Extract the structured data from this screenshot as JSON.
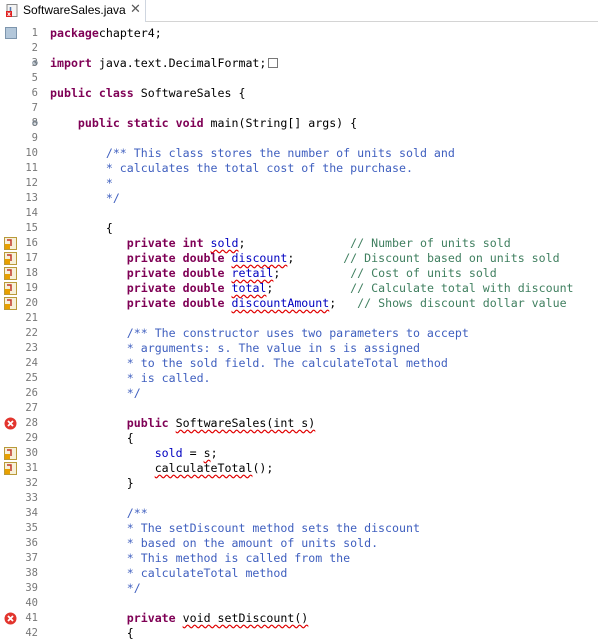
{
  "tab": {
    "title": "SoftwareSales.java",
    "close": "✕"
  },
  "colors": {
    "keyword": "#7f0055",
    "comment": "#3f7f5f",
    "javadoc": "#3f5fbf",
    "field": "#0000c0",
    "error": "#e00000",
    "warning": "#f0b400"
  },
  "lines": [
    {
      "n": "1",
      "m": "",
      "parts": [
        [
          "kw",
          "package"
        ],
        [
          "",
          "chapter4;"
        ]
      ]
    },
    {
      "n": "2",
      "m": "",
      "parts": []
    },
    {
      "n": "3",
      "m": "",
      "fold": "⊕",
      "parts": [
        [
          "kw",
          "import"
        ],
        [
          "",
          " java.text.DecimalFormat;"
        ]
      ],
      "box": true
    },
    {
      "n": "5",
      "m": "",
      "parts": []
    },
    {
      "n": "6",
      "m": "",
      "parts": [
        [
          "kw",
          "public class"
        ],
        [
          "",
          " SoftwareSales {"
        ]
      ]
    },
    {
      "n": "7",
      "m": "",
      "parts": []
    },
    {
      "n": "8",
      "m": "",
      "fold": "⊖",
      "parts": [
        [
          "",
          "    "
        ],
        [
          "kw",
          "public static void"
        ],
        [
          "",
          " main(String[] args) {"
        ]
      ]
    },
    {
      "n": "9",
      "m": "",
      "parts": []
    },
    {
      "n": "10",
      "m": "",
      "parts": [
        [
          "jd",
          "        /** This class stores the number of units sold and"
        ]
      ]
    },
    {
      "n": "11",
      "m": "",
      "parts": [
        [
          "jd",
          "        * calculates the total cost of the purchase."
        ]
      ]
    },
    {
      "n": "12",
      "m": "",
      "parts": [
        [
          "jd",
          "        *"
        ]
      ]
    },
    {
      "n": "13",
      "m": "",
      "parts": [
        [
          "jd",
          "        */"
        ]
      ]
    },
    {
      "n": "14",
      "m": "",
      "parts": []
    },
    {
      "n": "15",
      "m": "",
      "parts": [
        [
          "",
          "        {"
        ]
      ]
    },
    {
      "n": "16",
      "m": "warn",
      "parts": [
        [
          "",
          "           "
        ],
        [
          "kw",
          "private int"
        ],
        [
          "",
          " "
        ],
        [
          "errf",
          "sold"
        ],
        [
          "",
          ";"
        ],
        [
          "",
          "               "
        ],
        [
          "cm",
          "// Number of units sold"
        ]
      ]
    },
    {
      "n": "17",
      "m": "warn",
      "parts": [
        [
          "",
          "           "
        ],
        [
          "kw",
          "private double"
        ],
        [
          "",
          " "
        ],
        [
          "errf",
          "discount"
        ],
        [
          "",
          ";"
        ],
        [
          "",
          "       "
        ],
        [
          "cm",
          "// Discount based on units sold"
        ]
      ]
    },
    {
      "n": "18",
      "m": "warn",
      "parts": [
        [
          "",
          "           "
        ],
        [
          "kw",
          "private double"
        ],
        [
          "",
          " "
        ],
        [
          "errf",
          "retail"
        ],
        [
          "",
          ";"
        ],
        [
          "",
          "          "
        ],
        [
          "cm",
          "// Cost of units sold"
        ]
      ]
    },
    {
      "n": "19",
      "m": "warn",
      "parts": [
        [
          "",
          "           "
        ],
        [
          "kw",
          "private double"
        ],
        [
          "",
          " "
        ],
        [
          "errf",
          "total"
        ],
        [
          "",
          ";"
        ],
        [
          "",
          "           "
        ],
        [
          "cm",
          "// Calculate total with discount"
        ]
      ]
    },
    {
      "n": "20",
      "m": "warn",
      "parts": [
        [
          "",
          "           "
        ],
        [
          "kw",
          "private double"
        ],
        [
          "",
          " "
        ],
        [
          "errf",
          "discountAmount"
        ],
        [
          "",
          ";"
        ],
        [
          "",
          "   "
        ],
        [
          "cm",
          "// Shows discount dollar value"
        ]
      ]
    },
    {
      "n": "21",
      "m": "",
      "parts": []
    },
    {
      "n": "22",
      "m": "",
      "parts": [
        [
          "jd",
          "           /** The constructor uses two parameters to accept"
        ]
      ]
    },
    {
      "n": "23",
      "m": "",
      "parts": [
        [
          "jd",
          "           * arguments: s. The value in s is assigned"
        ]
      ]
    },
    {
      "n": "24",
      "m": "",
      "parts": [
        [
          "jd",
          "           * to the sold field. The calculateTotal method"
        ]
      ]
    },
    {
      "n": "25",
      "m": "",
      "parts": [
        [
          "jd",
          "           * is called."
        ]
      ]
    },
    {
      "n": "26",
      "m": "",
      "parts": [
        [
          "jd",
          "           */"
        ]
      ]
    },
    {
      "n": "27",
      "m": "",
      "parts": []
    },
    {
      "n": "28",
      "m": "err",
      "parts": [
        [
          "",
          "           "
        ],
        [
          "kw",
          "public"
        ],
        [
          "",
          " "
        ],
        [
          "err",
          "SoftwareSales(int s)"
        ]
      ]
    },
    {
      "n": "29",
      "m": "",
      "parts": [
        [
          "",
          "           {"
        ]
      ]
    },
    {
      "n": "30",
      "m": "warn",
      "parts": [
        [
          "",
          "               "
        ],
        [
          "fld",
          "sold"
        ],
        [
          "",
          " = "
        ],
        [
          "err",
          "s"
        ],
        [
          "",
          ";"
        ]
      ]
    },
    {
      "n": "31",
      "m": "warn",
      "parts": [
        [
          "",
          "               "
        ],
        [
          "err",
          "calculateTotal"
        ],
        [
          "",
          "();"
        ]
      ]
    },
    {
      "n": "32",
      "m": "",
      "parts": [
        [
          "",
          "           }"
        ]
      ]
    },
    {
      "n": "33",
      "m": "",
      "parts": []
    },
    {
      "n": "34",
      "m": "",
      "parts": [
        [
          "jd",
          "           /**"
        ]
      ]
    },
    {
      "n": "35",
      "m": "",
      "parts": [
        [
          "jd",
          "           * The setDiscount method sets the discount"
        ]
      ]
    },
    {
      "n": "36",
      "m": "",
      "parts": [
        [
          "jd",
          "           * based on the amount of units sold."
        ]
      ]
    },
    {
      "n": "37",
      "m": "",
      "parts": [
        [
          "jd",
          "           * This method is called from the"
        ]
      ]
    },
    {
      "n": "38",
      "m": "",
      "parts": [
        [
          "jd",
          "           * calculateTotal method"
        ]
      ]
    },
    {
      "n": "39",
      "m": "",
      "parts": [
        [
          "jd",
          "           */"
        ]
      ]
    },
    {
      "n": "40",
      "m": "",
      "parts": []
    },
    {
      "n": "41",
      "m": "err",
      "parts": [
        [
          "",
          "           "
        ],
        [
          "kw",
          "private"
        ],
        [
          "",
          " "
        ],
        [
          "err",
          "void setDiscount()"
        ]
      ]
    },
    {
      "n": "42",
      "m": "",
      "parts": [
        [
          "",
          "           {"
        ]
      ]
    }
  ]
}
